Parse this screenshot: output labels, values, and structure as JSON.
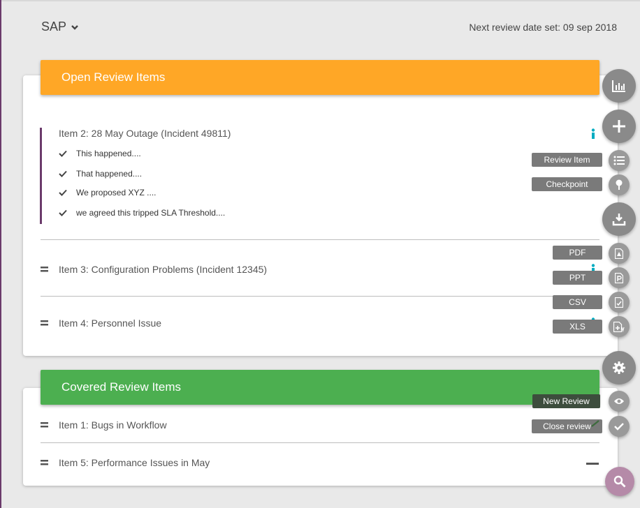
{
  "header": {
    "app_name": "SAP",
    "next_review": "Next review date set: 09 sep 2018"
  },
  "open_section": {
    "title": "Open Review Items",
    "expanded_item": {
      "title": "Item 2: 28 May Outage (Incident 49811)",
      "bullets": [
        "This happened....",
        "That happened....",
        "We proposed XYZ ....",
        "we agreed this tripped SLA Threshold...."
      ]
    },
    "items": [
      "Item 3: Configuration Problems (Incident 12345)",
      "Item 4: Personnel Issue"
    ]
  },
  "covered_section": {
    "title": "Covered Review Items",
    "items": [
      "Item 1: Bugs in Workflow",
      "Item 5: Performance Issues in May"
    ]
  },
  "fab_menu": {
    "review_item_label": "Review Item",
    "checkpoint_label": "Checkpoint",
    "pdf_label": "PDF",
    "ppt_label": "PPT",
    "csv_label": "CSV",
    "xls_label": "XLS",
    "new_review_label": "New Review",
    "close_review_label": "Close review"
  },
  "colors": {
    "open_header": "#ffa726",
    "covered_header": "#4caf50",
    "accent_purple": "#6b3a6b",
    "info_teal": "#00acc1"
  }
}
